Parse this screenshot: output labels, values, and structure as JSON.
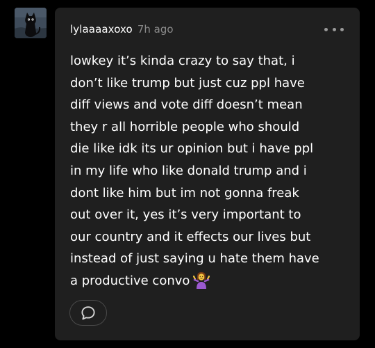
{
  "post": {
    "username": "lylaaaaxoxo",
    "timestamp": "7h ago",
    "body_lines": [
      "lowkey it’s kinda crazy to say that, i",
      "don’t like trump but just cuz ppl have",
      "diff views and vote diff doesn’t mean",
      "they r all horrible people who should",
      "die like idk its ur opinion but i have ppl",
      "in my life who like donald trump and i",
      "dont like him but im not gonna freak",
      "out over it, yes it’s very important to",
      "our country and it effects our lives but",
      "instead of just saying u hate them have",
      "a productive convo"
    ],
    "emoji": "person-shrugging-emoji"
  },
  "icons": {
    "avatar": "black-cat-avatar",
    "more": "more-options-icon",
    "reply": "speech-bubble-icon"
  },
  "colors": {
    "background": "#000000",
    "card": "#1f1f1f",
    "text": "#ffffff",
    "muted": "#8a8a8a"
  }
}
